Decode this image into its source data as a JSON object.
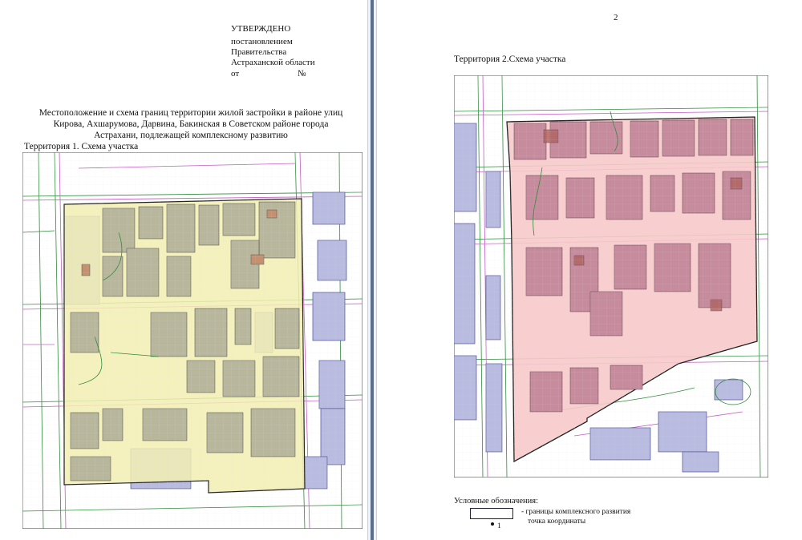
{
  "left_page": {
    "approval": {
      "title": "УТВЕРЖДЕНО",
      "line1": "постановлением",
      "line2": "Правительства",
      "line3": "Астраханской области",
      "line4_prefix": "от",
      "line4_suffix": "№"
    },
    "heading": {
      "line1": "Местоположение и схема границ территории жилой застройки в районе улиц",
      "line2": "Кирова, Ахшарумова, Дарвина, Бакинская в Советском районе города",
      "line3": "Астрахани, подлежащей комплексному развитию"
    },
    "map_caption": "Территория 1. Схема участка",
    "colors": {
      "zone_fill": "#f2eeb0",
      "building_fill": "#b8b79c",
      "neighbour_fill": "#b9bbe0"
    }
  },
  "right_page": {
    "page_number": "2",
    "map_caption": "Территория 2.Схема участка",
    "legend": {
      "title": "Условные обозначения:",
      "boundary_label": "- границы комплексного развития",
      "point_label": "точка координаты",
      "point_number": "1"
    },
    "colors": {
      "zone_fill": "#f7c9c9",
      "building_fill": "#c68b9c",
      "neighbour_fill": "#b9bbe0"
    }
  }
}
